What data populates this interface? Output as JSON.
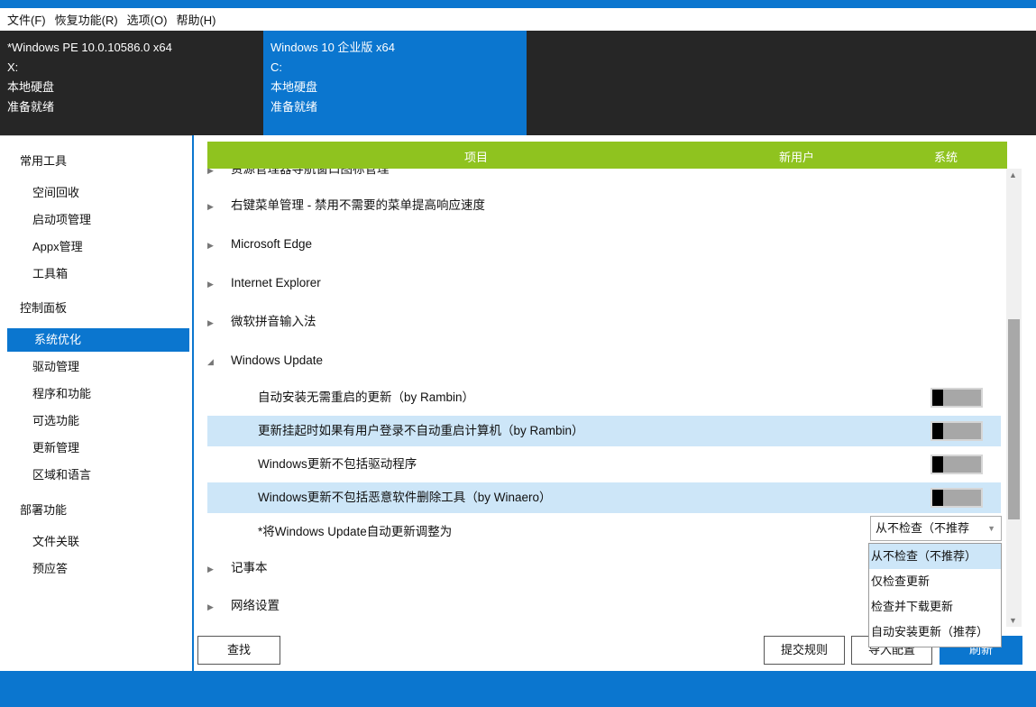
{
  "menu": [
    "文件(F)",
    "恢复功能(R)",
    "选项(O)",
    "帮助(H)"
  ],
  "systems": [
    {
      "name": "*Windows PE 10.0.10586.0 x64",
      "drive": "X:",
      "type": "本地硬盘",
      "status": "准备就绪"
    },
    {
      "name": "Windows 10 企业版 x64",
      "drive": "C:",
      "type": "本地硬盘",
      "status": "准备就绪"
    }
  ],
  "sidebar": {
    "groups": [
      "常用工具",
      "控制面板",
      "部署功能"
    ],
    "items": [
      "空间回收",
      "启动项管理",
      "Appx管理",
      "工具箱",
      "系统优化",
      "驱动管理",
      "程序和功能",
      "可选功能",
      "更新管理",
      "区域和语言",
      "文件关联",
      "预应答"
    ],
    "selected": "系统优化"
  },
  "table": {
    "headers": {
      "item": "项目",
      "user": "新用户",
      "system": "系统"
    },
    "partial_row": "资源管理器导航窗口图标管理",
    "groups": [
      "右键菜单管理 - 禁用不需要的菜单提高响应速度",
      "Microsoft Edge",
      "Internet Explorer",
      "微软拼音输入法",
      "Windows Update",
      "记事本",
      "网络设置"
    ],
    "update_items": [
      "自动安装无需重启的更新（by Rambin）",
      "更新挂起时如果有用户登录不自动重启计算机（by Rambin）",
      "Windows更新不包括驱动程序",
      "Windows更新不包括恶意软件删除工具（by Winaero）"
    ],
    "auto_update_label": "*将Windows Update自动更新调整为"
  },
  "combo": {
    "value": "从不检查（不推荐",
    "options": [
      "从不检查（不推荐）",
      "仅检查更新",
      "检查并下载更新",
      "自动安装更新（推荐）"
    ]
  },
  "buttons": {
    "find": "查找",
    "submit": "提交规则",
    "import": "导入配置",
    "refresh": "刷新"
  }
}
